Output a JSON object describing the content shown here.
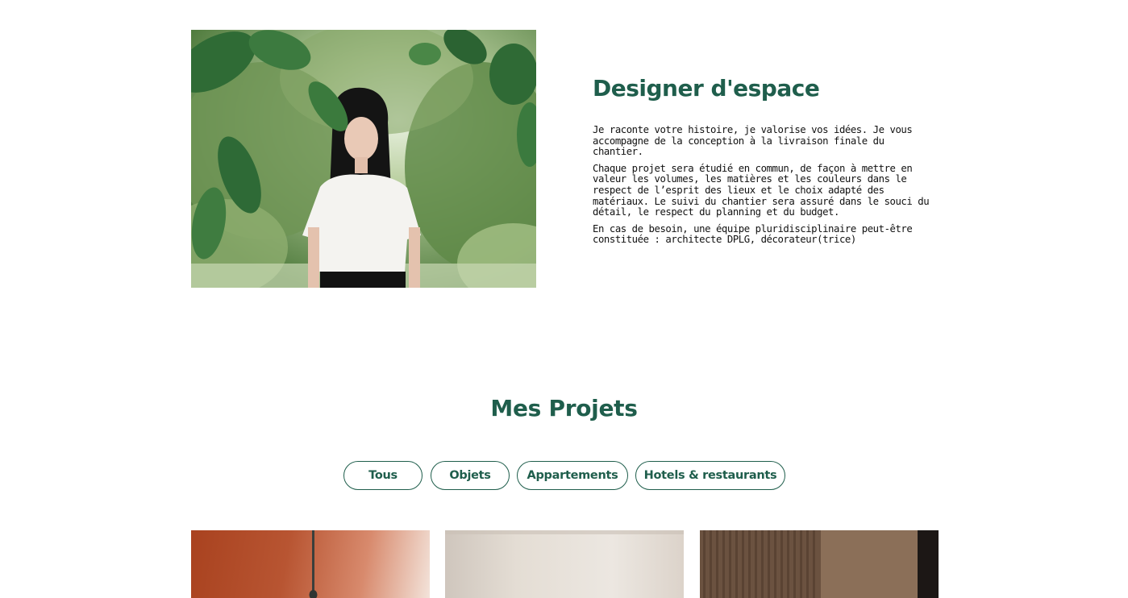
{
  "about": {
    "title": "Designer d'espace",
    "paragraphs": [
      "Je raconte votre histoire, je valorise vos idées. Je vous accompagne de la conception à la livraison finale du chantier.",
      "Chaque projet sera étudié en commun, de façon à mettre en valeur les volumes, les matières et les couleurs dans le respect de l’esprit des lieux et le choix adapté des matériaux. Le suivi du chantier sera assuré dans le souci du détail, le respect du planning et du budget.",
      "En cas de besoin, une équipe pluridisciplinaire peut-être constituée : architecte DPLG, décorateur(trice)"
    ]
  },
  "projects": {
    "title": "Mes Projets",
    "filters": [
      {
        "label": "Tous"
      },
      {
        "label": "Objets"
      },
      {
        "label": "Appartements"
      },
      {
        "label": "Hotels & restaurants"
      }
    ]
  },
  "colors": {
    "accent": "#1f5e4c",
    "text": "#111111",
    "background": "#ffffff"
  }
}
